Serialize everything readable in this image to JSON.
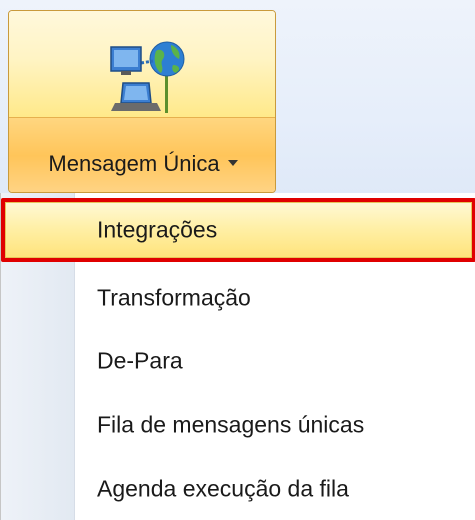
{
  "ribbon": {
    "button_label": "Mensagem Única",
    "icon": "network-computer-globe-icon",
    "dropdown_icon": "chevron-down-icon"
  },
  "menu": {
    "items": [
      {
        "label": "Integrações",
        "highlighted": true
      },
      {
        "label": "Transformação",
        "highlighted": false
      },
      {
        "label": "De-Para",
        "highlighted": false
      },
      {
        "label": "Fila de mensagens únicas",
        "highlighted": false
      },
      {
        "label": "Agenda execução da fila",
        "highlighted": false
      }
    ]
  },
  "colors": {
    "highlight_border": "#e00000",
    "hover_yellow": "#ffe37a",
    "ribbon_orange": "#ffc55a"
  }
}
